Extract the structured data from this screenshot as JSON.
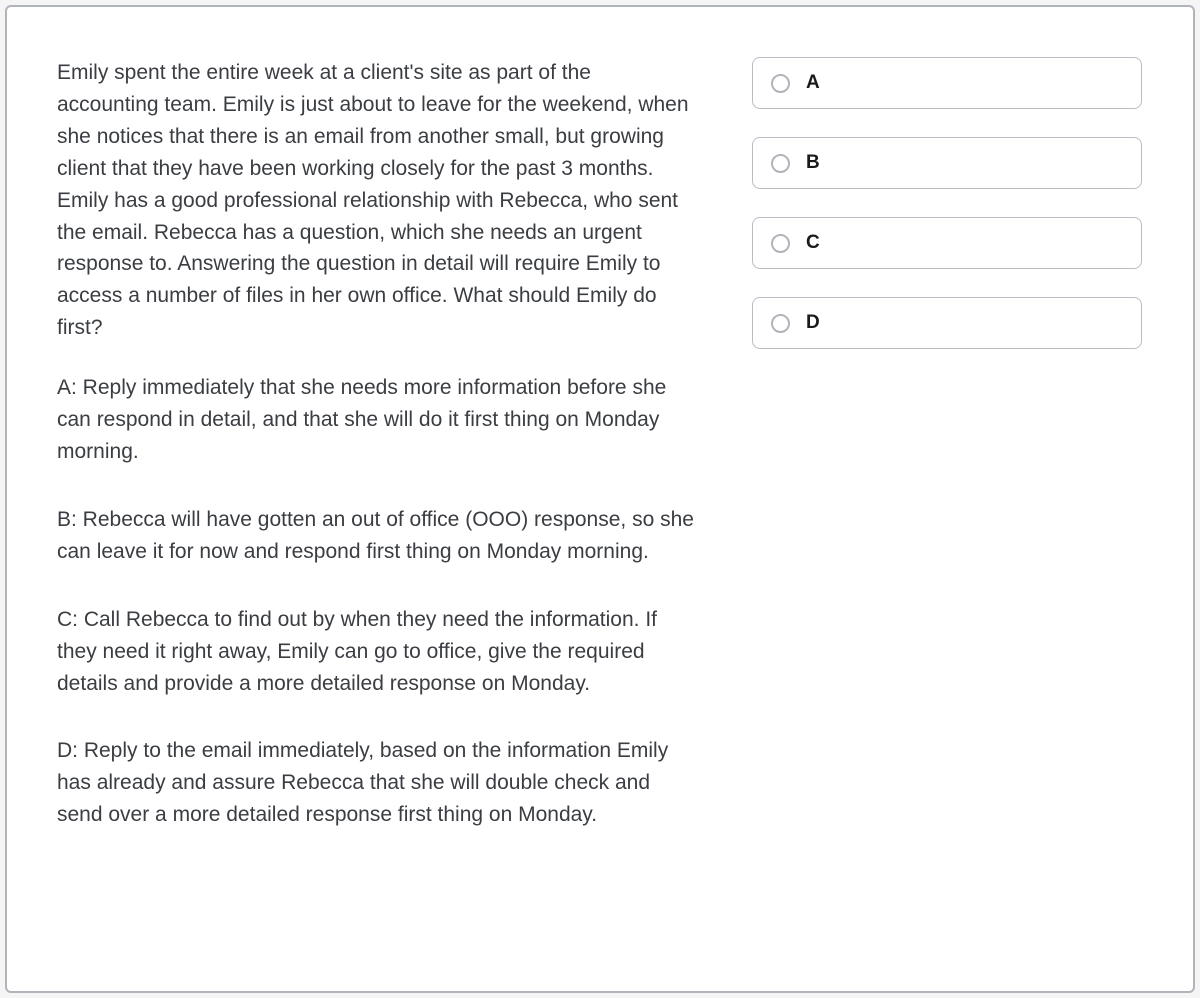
{
  "question": "Emily spent the entire week at a client's site as part of the accounting team. Emily is just about to leave for the weekend, when she notices that there is an email from another small, but growing client that they have been working closely for the past 3 months. Emily has a good professional relationship with Rebecca, who sent the email. Rebecca has a question, which she needs an urgent response to. Answering the question in detail will require Emily to access a number of files in her own office. What should Emily do first?",
  "answers": {
    "a": "A: Reply immediately that she needs more information before she can respond in detail, and that she will do it first thing on Monday morning.",
    "b": "B: Rebecca will have gotten an out of office (OOO) response, so she can leave it for now and respond first thing on Monday morning.",
    "c": "C: Call Rebecca to find out by when they need the information. If they need it right away, Emily can go to office, give the required details and provide a more detailed response on Monday.",
    "d": "D: Reply to the email immediately, based on the information Emily has already and assure Rebecca that she will double check and send over a more detailed response first thing on Monday."
  },
  "options": {
    "a": "A",
    "b": "B",
    "c": "C",
    "d": "D"
  }
}
